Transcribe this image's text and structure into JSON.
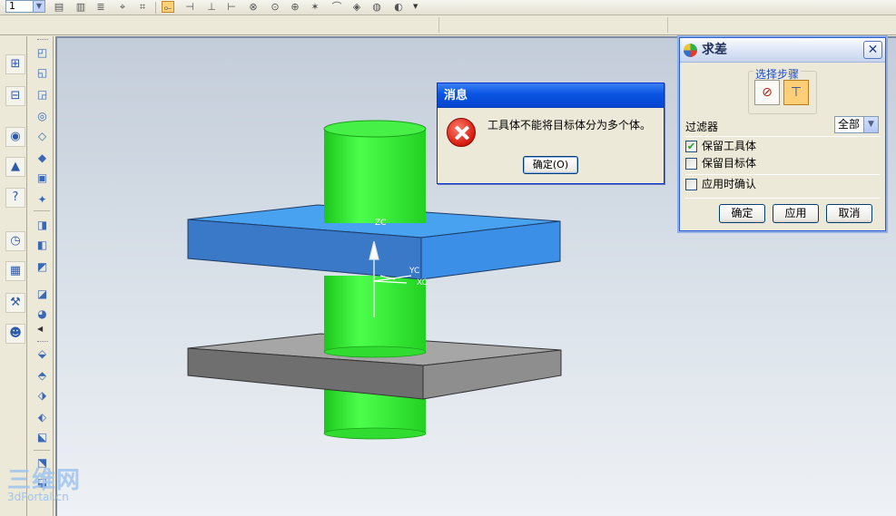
{
  "toolbar": {
    "layer_value": "1",
    "icons": [
      "open-file-icon",
      "save-icon",
      "layers-icon",
      "measure-icon",
      "analysis-icon",
      "snap-point-icon",
      "snap-end-icon",
      "snap-mid-icon",
      "snap-control-icon",
      "snap-intersect-icon",
      "snap-center-icon",
      "snap-quadrant-icon",
      "snap-existing-icon",
      "snap-on-curve-icon",
      "snap-on-face-icon",
      "snap-arc-icon"
    ]
  },
  "resource_bar": {
    "icons": [
      "assembly-navigator-icon",
      "part-navigator-icon",
      "web-browser-icon",
      "training-icon",
      "help-icon",
      "history-icon",
      "system-materials-icon",
      "process-studio-icon",
      "roles-icon"
    ]
  },
  "feature_toolbar": {
    "icons": [
      "extrude-icon",
      "revolve-icon",
      "sweep-icon",
      "hole-icon",
      "boss-icon",
      "pocket-icon",
      "pad-icon",
      "slot-icon",
      "groove-icon",
      "block-icon",
      "cylinder-icon",
      "cone-icon",
      "sphere-icon",
      "unite-icon",
      "subtract-icon",
      "intersect-icon",
      "edge-blend-icon",
      "chamfer-icon",
      "shell-icon",
      "offset-face-icon",
      "trim-body-icon"
    ]
  },
  "graphics": {
    "axis_labels": {
      "zc": "ZC",
      "yc": "YC",
      "xc": "XC"
    },
    "colors": {
      "cylinder": "#2ee62e",
      "top_plate": "#3a8ee0",
      "bottom_plate": "#8a8a8a"
    }
  },
  "message_dialog": {
    "title": "消息",
    "icon": "error-icon",
    "text": "工具体不能将目标体分为多个体。",
    "ok_label": "确定(O)"
  },
  "subtract_dialog": {
    "title": "求差",
    "step_group_label": "选择步骤",
    "step_icons": [
      "target-body-icon",
      "tool-body-icon"
    ],
    "filter_label": "过滤器",
    "filter_value": "全部",
    "checkboxes": [
      {
        "label": "保留工具体",
        "checked": true
      },
      {
        "label": "保留目标体",
        "checked": false
      },
      {
        "label": "应用时确认",
        "checked": false
      }
    ],
    "buttons": {
      "ok": "确定",
      "apply": "应用",
      "cancel": "取消"
    }
  },
  "watermark": {
    "logo": "三维网",
    "url": "3dPortal.cn"
  }
}
